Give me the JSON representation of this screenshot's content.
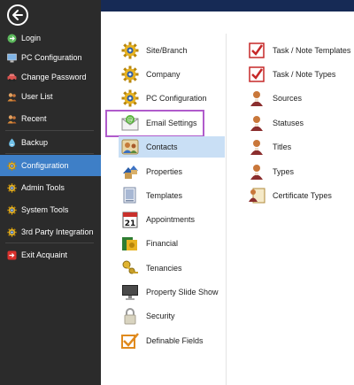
{
  "sidebar": {
    "items": [
      {
        "label": "Login",
        "icon": "login-icon"
      },
      {
        "label": "PC Configuration",
        "icon": "pc-icon"
      },
      {
        "label": "Change Password",
        "icon": "car-icon"
      },
      {
        "label": "User List",
        "icon": "users-icon"
      },
      {
        "label": "Recent",
        "icon": "recent-icon"
      },
      {
        "label": "Backup",
        "icon": "backup-icon"
      },
      {
        "label": "Configuration",
        "icon": "gear-icon"
      },
      {
        "label": "Admin Tools",
        "icon": "gear-icon"
      },
      {
        "label": "System Tools",
        "icon": "gear-icon"
      },
      {
        "label": "3rd Party Integration",
        "icon": "gear-icon"
      },
      {
        "label": "Exit Acquaint",
        "icon": "exit-icon"
      }
    ],
    "active": "Configuration"
  },
  "content": {
    "left_column": [
      {
        "label": "Site/Branch",
        "icon": "gear-icon"
      },
      {
        "label": "Company",
        "icon": "gear-icon"
      },
      {
        "label": "PC Configuration",
        "icon": "gear-icon"
      },
      {
        "label": "Email Settings",
        "icon": "email-icon"
      },
      {
        "label": "Contacts",
        "icon": "contacts-icon"
      },
      {
        "label": "Properties",
        "icon": "properties-icon"
      },
      {
        "label": "Templates",
        "icon": "templates-icon"
      },
      {
        "label": "Appointments",
        "icon": "calendar-icon"
      },
      {
        "label": "Financial",
        "icon": "financial-icon"
      },
      {
        "label": "Tenancies",
        "icon": "keys-icon"
      },
      {
        "label": "Property Slide Show",
        "icon": "monitor-icon"
      },
      {
        "label": "Security",
        "icon": "lock-icon"
      },
      {
        "label": "Definable Fields",
        "icon": "checkbox-icon"
      }
    ],
    "right_column": [
      {
        "label": "Task / Note Templates",
        "icon": "checkmark-icon"
      },
      {
        "label": "Task / Note Types",
        "icon": "checkmark-icon"
      },
      {
        "label": "Sources",
        "icon": "person-icon"
      },
      {
        "label": "Statuses",
        "icon": "person-icon"
      },
      {
        "label": "Titles",
        "icon": "person-icon"
      },
      {
        "label": "Types",
        "icon": "person-icon"
      },
      {
        "label": "Certificate Types",
        "icon": "certificate-icon"
      }
    ],
    "selected": "Contacts",
    "highlighted": "Email Settings"
  },
  "colors": {
    "sidebar_bg": "#2b2b2b",
    "active_bg": "#3e7fc7",
    "top_band": "#162a55",
    "selected_bg": "#c9dff5",
    "highlight_border": "#b05bcc"
  }
}
